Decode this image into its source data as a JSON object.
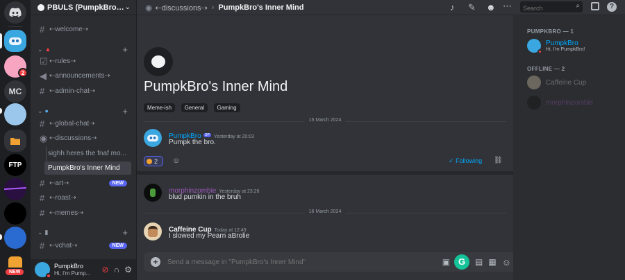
{
  "server": {
    "name": "PBULS (PumpkBro's ...",
    "rail_badge": "2",
    "rail_initials": "MC",
    "rail_new": "NEW"
  },
  "sidebar": {
    "channels": [
      {
        "label": "⇠welcome⇢"
      },
      {
        "label": "⇠rules⇢"
      },
      {
        "label": "⇠announcements⇢"
      },
      {
        "label": "⇠admin-chat⇢"
      },
      {
        "label": "⇠global-chat⇢"
      },
      {
        "label": "⇠discussions⇢"
      },
      {
        "label": "sighh heres the fnaf mo..."
      },
      {
        "label": "PumpkBro's Inner Mind"
      },
      {
        "label": "⇠art⇢",
        "badge": "NEW"
      },
      {
        "label": "⇠roast⇢"
      },
      {
        "label": "⇠memes⇢"
      },
      {
        "label": "⇠vchat⇢",
        "badge": "NEW"
      }
    ]
  },
  "user": {
    "name": "PumpkBro",
    "status": "Hi, I'm Pump..."
  },
  "topbar": {
    "parent": "⇠discussions⇢",
    "thread": "PumpkBro's Inner Mind",
    "search_placeholder": "Search"
  },
  "post": {
    "title": "PumpkBro's Inner Mind",
    "tags": [
      "Meme-ish",
      "General",
      "Gaming"
    ],
    "reaction_count": "2",
    "follow_label": "Following"
  },
  "dates": {
    "first": "15 March 2024",
    "second": "16 March 2024"
  },
  "messages": [
    {
      "author": "PumpkBro",
      "op": "OP",
      "time": "Yesterday at 20:03",
      "text": "Pumpk the bro.",
      "color": "#00a8fc"
    },
    {
      "author": "morphinzombie",
      "time": "Yesterday at 23:26",
      "text": "blud pumkin in the bruh",
      "color": "#9b59b6"
    },
    {
      "author": "Caffeine Cup",
      "time": "Today at 12:49",
      "text": "I slowed my Pearn aBrolie",
      "color": "#f2f3f5"
    }
  ],
  "composer": {
    "placeholder": "Send a message in \"PumpkBro's Inner Mind\""
  },
  "members_panel": {
    "online_header": "PUMPKBRO — 1",
    "offline_header": "OFFLINE — 2",
    "online": [
      {
        "name": "PumpkBro",
        "status": "Hi, I'm PumpkBro!"
      }
    ],
    "offline": [
      {
        "name": "Caffeine Cup"
      },
      {
        "name": "morphinzombie"
      }
    ]
  },
  "colors": {
    "accent": "#5865f2",
    "link": "#00a8fc",
    "danger": "#f23f43"
  }
}
